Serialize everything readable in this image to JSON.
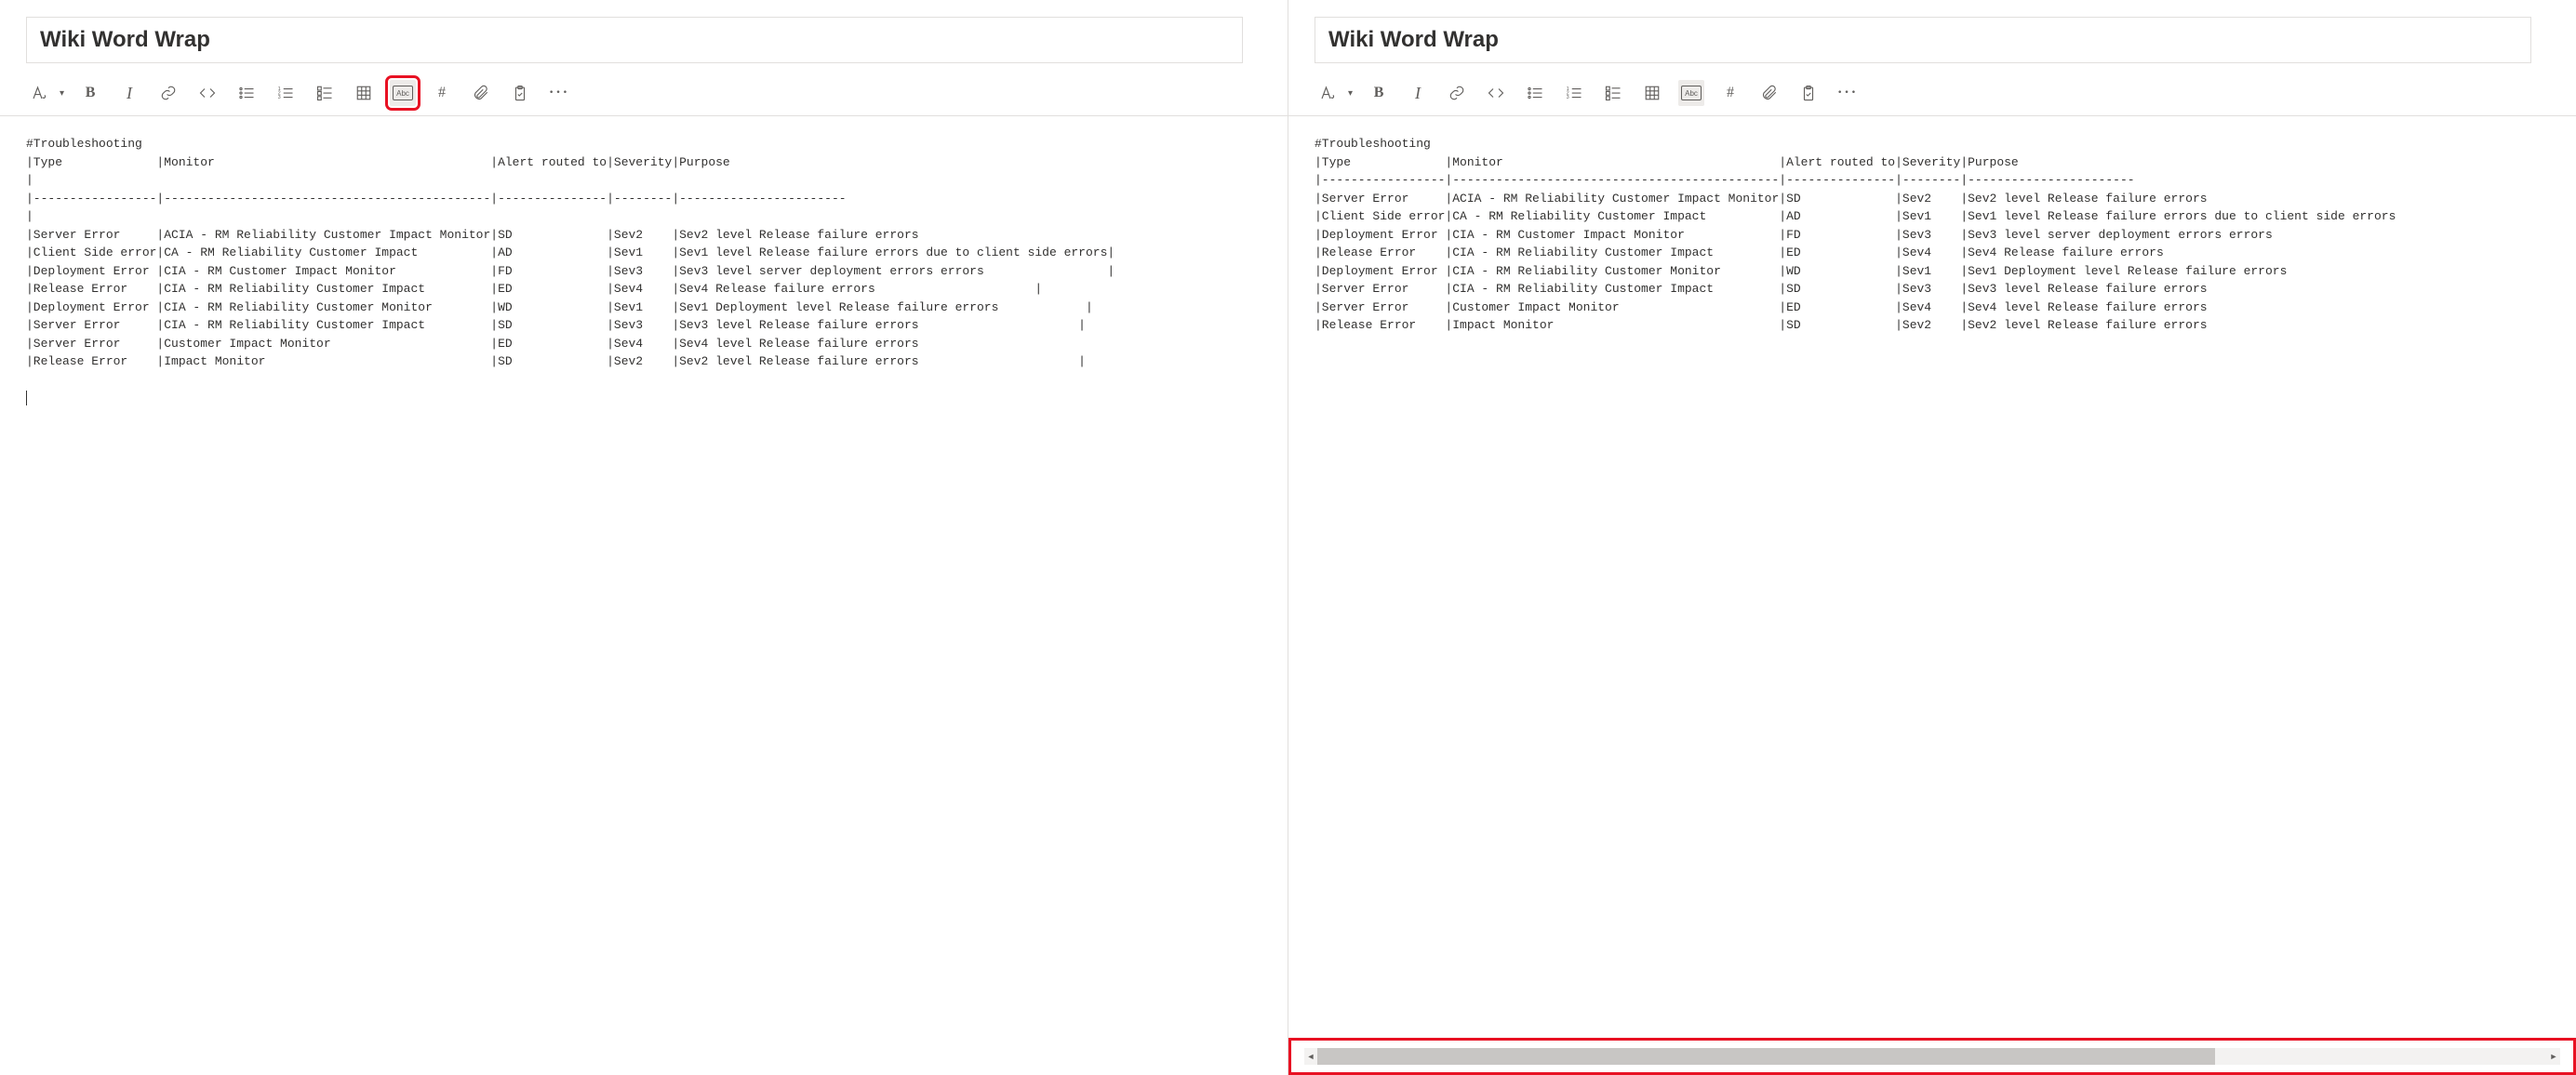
{
  "left": {
    "title": "Wiki Word Wrap",
    "wrap_highlighted": true,
    "content": "#Troubleshooting\n|Type             |Monitor                                      |Alert routed to|Severity|Purpose\n|\n|-----------------|---------------------------------------------|---------------|--------|-----------------------\n|\n|Server Error     |ACIA - RM Reliability Customer Impact Monitor|SD             |Sev2    |Sev2 level Release failure errors\n|Client Side error|CA - RM Reliability Customer Impact          |AD             |Sev1    |Sev1 level Release failure errors due to client side errors|\n|Deployment Error |CIA - RM Customer Impact Monitor             |FD             |Sev3    |Sev3 level server deployment errors errors                 |\n|Release Error    |CIA - RM Reliability Customer Impact         |ED             |Sev4    |Sev4 Release failure errors                      |\n|Deployment Error |CIA - RM Reliability Customer Monitor        |WD             |Sev1    |Sev1 Deployment level Release failure errors            |\n|Server Error     |CIA - RM Reliability Customer Impact         |SD             |Sev3    |Sev3 level Release failure errors                      |\n|Server Error     |Customer Impact Monitor                      |ED             |Sev4    |Sev4 level Release failure errors\n|Release Error    |Impact Monitor                               |SD             |Sev2    |Sev2 level Release failure errors                      |\n\n"
  },
  "right": {
    "title": "Wiki Word Wrap",
    "wrap_active": true,
    "scroll_highlighted": true,
    "content": "#Troubleshooting\n|Type             |Monitor                                      |Alert routed to|Severity|Purpose\n|-----------------|---------------------------------------------|---------------|--------|-----------------------\n|Server Error     |ACIA - RM Reliability Customer Impact Monitor|SD             |Sev2    |Sev2 level Release failure errors\n|Client Side error|CA - RM Reliability Customer Impact          |AD             |Sev1    |Sev1 level Release failure errors due to client side errors\n|Deployment Error |CIA - RM Customer Impact Monitor             |FD             |Sev3    |Sev3 level server deployment errors errors\n|Release Error    |CIA - RM Reliability Customer Impact         |ED             |Sev4    |Sev4 Release failure errors\n|Deployment Error |CIA - RM Reliability Customer Monitor        |WD             |Sev1    |Sev1 Deployment level Release failure errors\n|Server Error     |CIA - RM Reliability Customer Impact         |SD             |Sev3    |Sev3 level Release failure errors\n|Server Error     |Customer Impact Monitor                      |ED             |Sev4    |Sev4 level Release failure errors\n|Release Error    |Impact Monitor                               |SD             |Sev2    |Sev2 level Release failure errors"
  },
  "toolbar_labels": {
    "format": "Format",
    "bold": "B",
    "italic": "I",
    "link": "Link",
    "code": "</>",
    "ul": "Bulleted list",
    "ol": "Numbered list",
    "checklist": "Checklist",
    "table": "Table",
    "wrap": "Abc",
    "hash": "#",
    "attach": "Attach",
    "paste": "Paste",
    "more": "···"
  }
}
